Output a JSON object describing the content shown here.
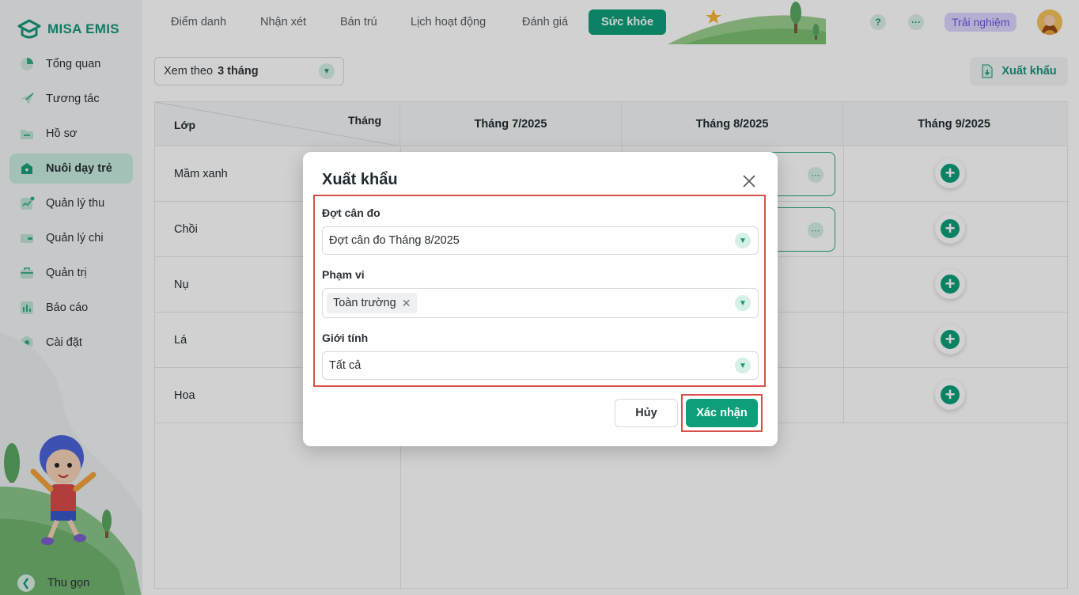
{
  "brand": {
    "logo_text": "MISA EMIS"
  },
  "sidebar": {
    "items": [
      {
        "label": "Tổng quan",
        "icon": "pie-chart-icon"
      },
      {
        "label": "Tương tác",
        "icon": "paper-plane-icon"
      },
      {
        "label": "Hồ sơ",
        "icon": "folder-icon"
      },
      {
        "label": "Nuôi dạy trẻ",
        "icon": "child-care-icon",
        "active": true
      },
      {
        "label": "Quản lý thu",
        "icon": "income-chart-icon"
      },
      {
        "label": "Quản lý chi",
        "icon": "wallet-icon"
      },
      {
        "label": "Quản trị",
        "icon": "briefcase-icon"
      },
      {
        "label": "Báo cáo",
        "icon": "bar-chart-icon"
      },
      {
        "label": "Cài đặt",
        "icon": "settings-icon"
      }
    ],
    "collapse_label": "Thu gọn"
  },
  "topbar": {
    "tabs": [
      {
        "label": "Điểm danh"
      },
      {
        "label": "Nhận xét"
      },
      {
        "label": "Bán trú"
      },
      {
        "label": "Lịch hoạt động"
      },
      {
        "label": "Đánh giá"
      },
      {
        "label": "Sức khỏe",
        "active": true
      }
    ],
    "help_label": "?",
    "more_label": "···",
    "trial_label": "Trải nghiệm"
  },
  "toolbar": {
    "view_prefix": "Xem theo",
    "view_value": "3 tháng",
    "export_label": "Xuất khẩu"
  },
  "table": {
    "corner_row_header": "Lớp",
    "corner_col_header": "Tháng",
    "months": [
      "Tháng 7/2025",
      "Tháng 8/2025",
      "Tháng 9/2025"
    ],
    "rows": [
      "Mầm xanh",
      "Chồi",
      "Nụ",
      "Lá",
      "Hoa"
    ]
  },
  "dialog": {
    "title": "Xuất khẩu",
    "field_period_label": "Đợt cân đo",
    "field_period_value": "Đợt cân đo Tháng 8/2025",
    "field_scope_label": "Phạm vi",
    "field_scope_tag": "Toàn trường",
    "field_gender_label": "Giới tính",
    "field_gender_value": "Tất cả",
    "cancel_label": "Hủy",
    "confirm_label": "Xác nhận"
  },
  "colors": {
    "primary": "#0e9f7a",
    "active_nav_bg": "#c9ece1",
    "highlight_border": "#d9524a",
    "trial_bg": "#dcd6ff",
    "trial_text": "#6a55e0"
  }
}
